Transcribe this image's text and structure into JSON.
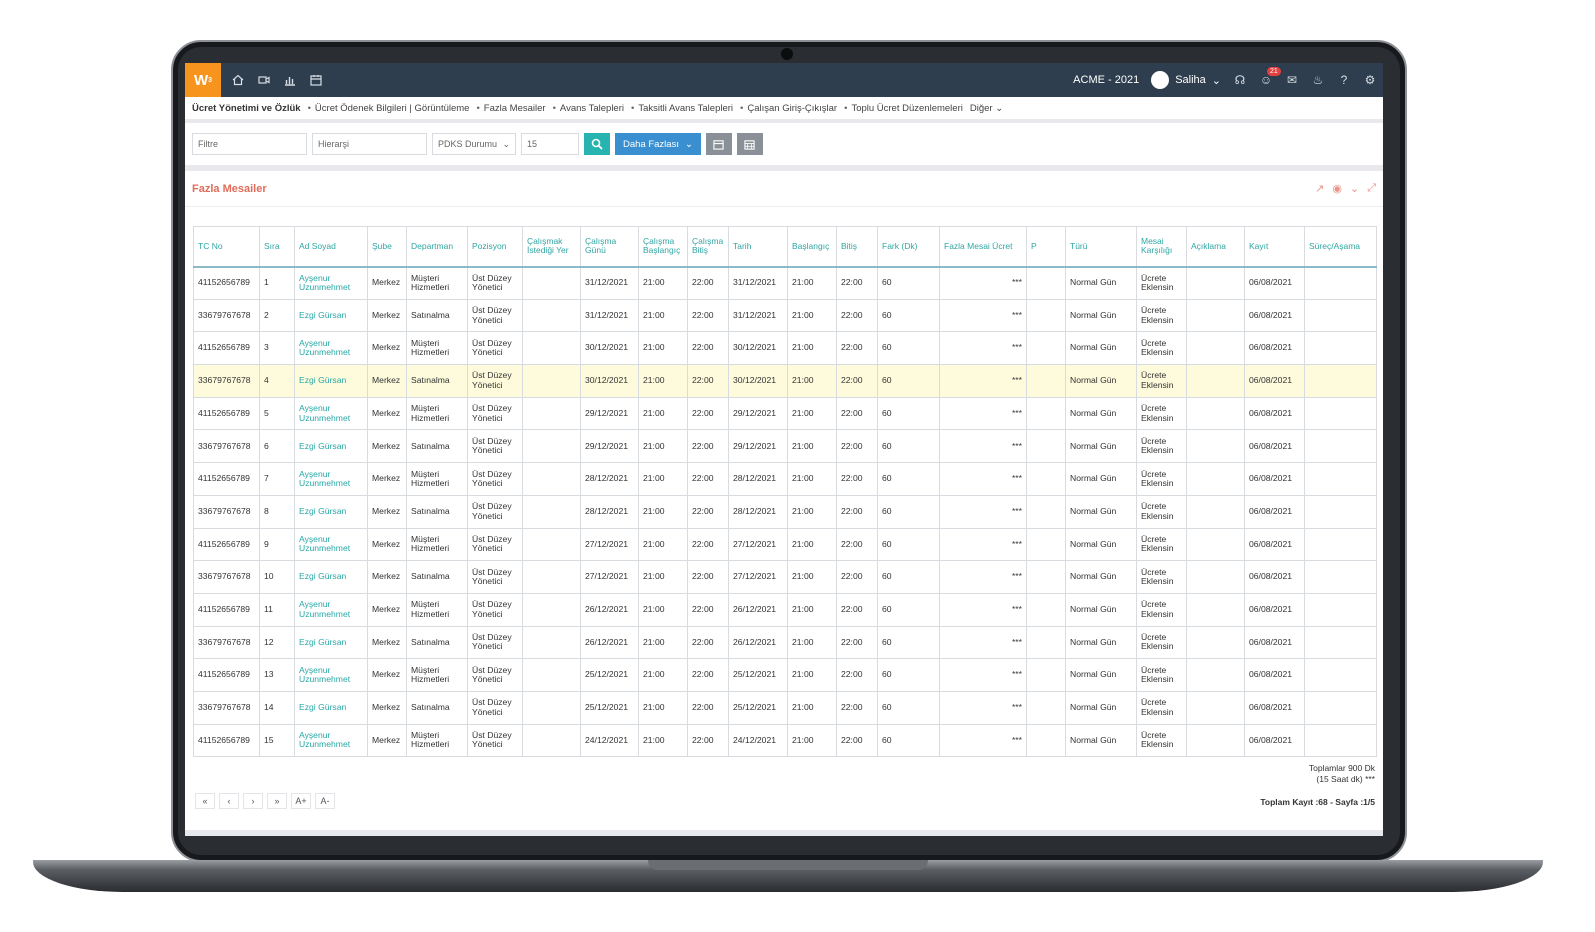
{
  "app": {
    "logo": "W",
    "logo_sup": "3",
    "company": "ACME - 2021",
    "user": "Saliha",
    "notif_count": "21"
  },
  "icons": [
    "home-icon",
    "video-icon",
    "chart-icon",
    "calendar-icon",
    "headset-icon",
    "emoji-icon",
    "chat-icon",
    "bell-icon",
    "help-icon",
    "gear-icon"
  ],
  "breadcrumb": {
    "root": "Ücret Yönetimi ve Özlük",
    "items": [
      "Ücret Ödenek Bilgileri | Görüntüleme",
      "Fazla Mesailer",
      "Avans Talepleri",
      "Taksitli Avans Talepleri",
      "Çalışan Giriş-Çıkışlar",
      "Toplu Ücret Düzenlemeleri"
    ],
    "more": "Diğer"
  },
  "filters": {
    "filter_placeholder": "Filtre",
    "hierarchy_placeholder": "Hierarşi",
    "pdks_label": "PDKS Durumu",
    "page_size": "15",
    "more_label": "Daha Fazlası"
  },
  "panel": {
    "title": "Fazla Mesailer"
  },
  "columns": [
    "TC No",
    "Sıra",
    "Ad Soyad",
    "Şube",
    "Departman",
    "Pozisyon",
    "Çalışmak İstediği Yer",
    "Çalışma Günü",
    "Çalışma Başlangıç",
    "Çalışma Bitiş",
    "Tarih",
    "Başlangıç",
    "Bitiş",
    "Fark (Dk)",
    "Fazla Mesai Ücret",
    "P",
    "Türü",
    "Mesai Karşılığı",
    "Açıklama",
    "Kayıt",
    "Süreç/Aşama"
  ],
  "rows": [
    [
      "41152656789",
      "1",
      "Ayşenur Uzunmehmet",
      "Merkez",
      "Müşteri Hizmetleri",
      "Üst Düzey Yönetici",
      "",
      "31/12/2021",
      "21:00",
      "22:00",
      "31/12/2021",
      "21:00",
      "22:00",
      "60",
      "***",
      "",
      "Normal Gün",
      "Ücrete Eklensin",
      "",
      "06/08/2021",
      ""
    ],
    [
      "33679767678",
      "2",
      "Ezgi Gürsan",
      "Merkez",
      "Satınalma",
      "Üst Düzey Yönetici",
      "",
      "31/12/2021",
      "21:00",
      "22:00",
      "31/12/2021",
      "21:00",
      "22:00",
      "60",
      "***",
      "",
      "Normal Gün",
      "Ücrete Eklensin",
      "",
      "06/08/2021",
      ""
    ],
    [
      "41152656789",
      "3",
      "Ayşenur Uzunmehmet",
      "Merkez",
      "Müşteri Hizmetleri",
      "Üst Düzey Yönetici",
      "",
      "30/12/2021",
      "21:00",
      "22:00",
      "30/12/2021",
      "21:00",
      "22:00",
      "60",
      "***",
      "",
      "Normal Gün",
      "Ücrete Eklensin",
      "",
      "06/08/2021",
      ""
    ],
    [
      "33679767678",
      "4",
      "Ezgi Gürsan",
      "Merkez",
      "Satınalma",
      "Üst Düzey Yönetici",
      "",
      "30/12/2021",
      "21:00",
      "22:00",
      "30/12/2021",
      "21:00",
      "22:00",
      "60",
      "***",
      "",
      "Normal Gün",
      "Ücrete Eklensin",
      "",
      "06/08/2021",
      ""
    ],
    [
      "41152656789",
      "5",
      "Ayşenur Uzunmehmet",
      "Merkez",
      "Müşteri Hizmetleri",
      "Üst Düzey Yönetici",
      "",
      "29/12/2021",
      "21:00",
      "22:00",
      "29/12/2021",
      "21:00",
      "22:00",
      "60",
      "***",
      "",
      "Normal Gün",
      "Ücrete Eklensin",
      "",
      "06/08/2021",
      ""
    ],
    [
      "33679767678",
      "6",
      "Ezgi Gürsan",
      "Merkez",
      "Satınalma",
      "Üst Düzey Yönetici",
      "",
      "29/12/2021",
      "21:00",
      "22:00",
      "29/12/2021",
      "21:00",
      "22:00",
      "60",
      "***",
      "",
      "Normal Gün",
      "Ücrete Eklensin",
      "",
      "06/08/2021",
      ""
    ],
    [
      "41152656789",
      "7",
      "Ayşenur Uzunmehmet",
      "Merkez",
      "Müşteri Hizmetleri",
      "Üst Düzey Yönetici",
      "",
      "28/12/2021",
      "21:00",
      "22:00",
      "28/12/2021",
      "21:00",
      "22:00",
      "60",
      "***",
      "",
      "Normal Gün",
      "Ücrete Eklensin",
      "",
      "06/08/2021",
      ""
    ],
    [
      "33679767678",
      "8",
      "Ezgi Gürsan",
      "Merkez",
      "Satınalma",
      "Üst Düzey Yönetici",
      "",
      "28/12/2021",
      "21:00",
      "22:00",
      "28/12/2021",
      "21:00",
      "22:00",
      "60",
      "***",
      "",
      "Normal Gün",
      "Ücrete Eklensin",
      "",
      "06/08/2021",
      ""
    ],
    [
      "41152656789",
      "9",
      "Ayşenur Uzunmehmet",
      "Merkez",
      "Müşteri Hizmetleri",
      "Üst Düzey Yönetici",
      "",
      "27/12/2021",
      "21:00",
      "22:00",
      "27/12/2021",
      "21:00",
      "22:00",
      "60",
      "***",
      "",
      "Normal Gün",
      "Ücrete Eklensin",
      "",
      "06/08/2021",
      ""
    ],
    [
      "33679767678",
      "10",
      "Ezgi Gürsan",
      "Merkez",
      "Satınalma",
      "Üst Düzey Yönetici",
      "",
      "27/12/2021",
      "21:00",
      "22:00",
      "27/12/2021",
      "21:00",
      "22:00",
      "60",
      "***",
      "",
      "Normal Gün",
      "Ücrete Eklensin",
      "",
      "06/08/2021",
      ""
    ],
    [
      "41152656789",
      "11",
      "Ayşenur Uzunmehmet",
      "Merkez",
      "Müşteri Hizmetleri",
      "Üst Düzey Yönetici",
      "",
      "26/12/2021",
      "21:00",
      "22:00",
      "26/12/2021",
      "21:00",
      "22:00",
      "60",
      "***",
      "",
      "Normal Gün",
      "Ücrete Eklensin",
      "",
      "06/08/2021",
      ""
    ],
    [
      "33679767678",
      "12",
      "Ezgi Gürsan",
      "Merkez",
      "Satınalma",
      "Üst Düzey Yönetici",
      "",
      "26/12/2021",
      "21:00",
      "22:00",
      "26/12/2021",
      "21:00",
      "22:00",
      "60",
      "***",
      "",
      "Normal Gün",
      "Ücrete Eklensin",
      "",
      "06/08/2021",
      ""
    ],
    [
      "41152656789",
      "13",
      "Ayşenur Uzunmehmet",
      "Merkez",
      "Müşteri Hizmetleri",
      "Üst Düzey Yönetici",
      "",
      "25/12/2021",
      "21:00",
      "22:00",
      "25/12/2021",
      "21:00",
      "22:00",
      "60",
      "***",
      "",
      "Normal Gün",
      "Ücrete Eklensin",
      "",
      "06/08/2021",
      ""
    ],
    [
      "33679767678",
      "14",
      "Ezgi Gürsan",
      "Merkez",
      "Satınalma",
      "Üst Düzey Yönetici",
      "",
      "25/12/2021",
      "21:00",
      "22:00",
      "25/12/2021",
      "21:00",
      "22:00",
      "60",
      "***",
      "",
      "Normal Gün",
      "Ücrete Eklensin",
      "",
      "06/08/2021",
      ""
    ],
    [
      "41152656789",
      "15",
      "Ayşenur Uzunmehmet",
      "Merkez",
      "Müşteri Hizmetleri",
      "Üst Düzey Yönetici",
      "",
      "24/12/2021",
      "21:00",
      "22:00",
      "24/12/2021",
      "21:00",
      "22:00",
      "60",
      "***",
      "",
      "Normal Gün",
      "Ücrete Eklensin",
      "",
      "06/08/2021",
      ""
    ]
  ],
  "highlighted_row": 4,
  "totals": {
    "line1": "Toplamlar 900 Dk",
    "line2": "(15 Saat dk) ***"
  },
  "pager": {
    "first": "«",
    "prev": "‹",
    "next": "›",
    "last": "»",
    "font_up": "A+",
    "font_down": "A-"
  },
  "record_info": "Toplam Kayıt :68 -  Sayfa :1/5",
  "colors": {
    "topbar": "#2e3e4e",
    "logo": "#f7941d",
    "accent": "#27b3b0",
    "title": "#e06c5a",
    "highlight": "#fdfbdc"
  }
}
